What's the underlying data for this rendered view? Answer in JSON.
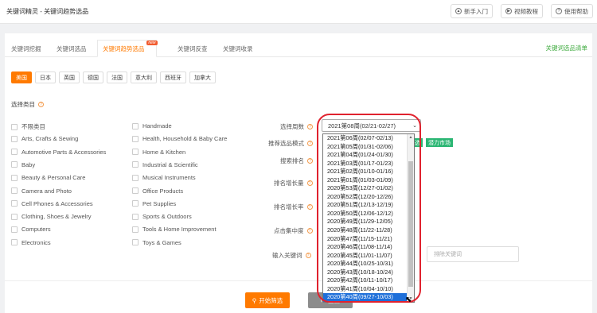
{
  "app": {
    "title": "关键词精灵 - 关键词趋势选品"
  },
  "header_buttons": [
    {
      "label": "新手入门",
      "icon": "graduation-icon"
    },
    {
      "label": "视频教程",
      "icon": "play-icon"
    },
    {
      "label": "使用帮助",
      "icon": "help-icon"
    }
  ],
  "tabs": [
    {
      "label": "关键词挖掘"
    },
    {
      "label": "关键词选品"
    },
    {
      "label": "关键词趋势选品",
      "badge": "new",
      "active": true
    },
    {
      "label": "关键词反查"
    },
    {
      "label": "关键词收录"
    }
  ],
  "tab_right": "关键词选品清单",
  "countries": [
    "美国",
    "日本",
    "英国",
    "德国",
    "法国",
    "意大利",
    "西班牙",
    "加拿大"
  ],
  "active_country": "美国",
  "category_title": "选择类目",
  "categories_col1": [
    "不限类目",
    "Arts, Crafts & Sewing",
    "Automotive Parts & Accessories",
    "Baby",
    "Beauty & Personal Care",
    "Camera and Photo",
    "Cell Phones & Accessories",
    "Clothing, Shoes & Jewelry",
    "Computers",
    "Electronics"
  ],
  "categories_col2": [
    "Handmade",
    "Health, Household & Baby Care",
    "Home & Kitchen",
    "Industrial & Scientific",
    "Musical Instruments",
    "Office Products",
    "Pet Supplies",
    "Sports & Outdoors",
    "Tools & Home Improvement",
    "Toys & Games"
  ],
  "filters": {
    "week_label": "选择周数",
    "mode_label": "推荐选品模式",
    "rank_label": "搜索排名",
    "rank_growth_label": "排名增长量",
    "rank_growth_rate_label": "排名增长率",
    "click_label": "点击集中度",
    "keyword_label": "输入关键词"
  },
  "week_select": {
    "value": "2021第08周(02/21-02/27)"
  },
  "mode_tags": [
    "选",
    "潜力市场"
  ],
  "exclude_placeholder": "排除关键词",
  "start_button": "开始筛选",
  "reset_button": "重置",
  "dropdown_options": [
    "2021第06周(02/07-02/13)",
    "2021第05周(01/31-02/06)",
    "2021第04周(01/24-01/30)",
    "2021第03周(01/17-01/23)",
    "2021第02周(01/10-01/16)",
    "2021第01周(01/03-01/09)",
    "2020第53周(12/27-01/02)",
    "2020第52周(12/20-12/26)",
    "2020第51周(12/13-12/19)",
    "2020第50周(12/06-12/12)",
    "2020第49周(11/29-12/05)",
    "2020第48周(11/22-11/28)",
    "2020第47周(11/15-11/21)",
    "2020第46周(11/08-11/14)",
    "2020第45周(11/01-11/07)",
    "2020第44周(10/25-10/31)",
    "2020第43周(10/18-10/24)",
    "2020第42周(10/11-10/17)",
    "2020第41周(10/04-10/10)",
    "2020第40周(09/27-10/03)"
  ],
  "highlighted_option": "2020第40周(09/27-10/03)",
  "colors": {
    "accent": "#ff7a00",
    "green": "#2bb673",
    "highlight": "#e0222e",
    "selection": "#1e6fd9"
  }
}
